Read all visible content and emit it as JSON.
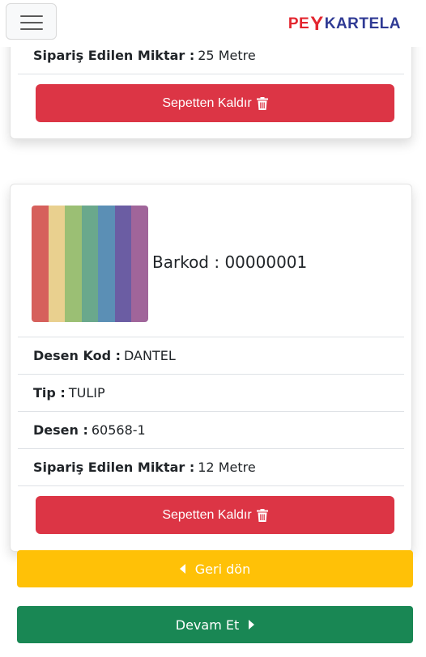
{
  "navbar": {
    "menu_icon": "hamburger-menu-icon",
    "brand_pe": "PE",
    "brand_y": "Y",
    "brand_rest": "KARTELA"
  },
  "items": [
    {
      "ordered_label": "Sipariş Edilen Miktar :",
      "ordered_value": "25 Metre",
      "remove_label": "Sepetten Kaldır",
      "remove_icon": "trash-icon"
    },
    {
      "barcode": "Barkod : 00000001",
      "swatch_colors": [
        "#d6605c",
        "#e9d08f",
        "#9bbf74",
        "#6aa88c",
        "#5b8fb5",
        "#6b5da3",
        "#a0659a"
      ],
      "pattern_code_label": "Desen Kod :",
      "pattern_code_value": "DANTEL",
      "type_label": "Tip :",
      "type_value": "TULIP",
      "pattern_label": "Desen :",
      "pattern_value": "60568-1",
      "ordered_label": "Sipariş Edilen Miktar :",
      "ordered_value": "12 Metre",
      "remove_label": "Sepetten Kaldır",
      "remove_icon": "trash-icon"
    }
  ],
  "actions": {
    "back_label": "Geri dön",
    "back_icon": "caret-left-icon",
    "next_label": "Devam Et",
    "next_icon": "caret-right-icon"
  },
  "colors": {
    "danger": "#dc3545",
    "warning": "#ffc107",
    "success": "#198754",
    "brand_red": "#e3262f",
    "brand_blue": "#2f3a94"
  }
}
